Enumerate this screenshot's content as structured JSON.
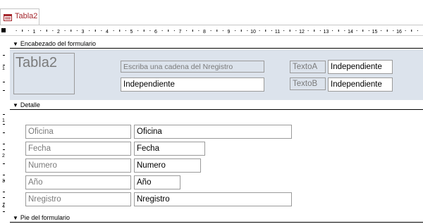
{
  "tab": {
    "label": "Tabla2"
  },
  "ruler": {
    "top_numbers": [
      "1",
      "2",
      "3",
      "4",
      "5",
      "6",
      "7",
      "8",
      "9",
      "10",
      "11",
      "12",
      "13",
      "14",
      "15",
      "16"
    ],
    "left_numbers": [
      "1",
      "1",
      "2",
      "3",
      "4"
    ]
  },
  "sections": {
    "header_label": "Encabezado del formulario",
    "detail_label": "Detalle",
    "footer_label": "Pie del formulario"
  },
  "header": {
    "title": "Tabla2",
    "prompt": "Escriba una cadena del Nregistro",
    "unbound_value": "Independiente",
    "textoA_label": "TextoA",
    "textoA_value": "Independiente",
    "textoB_label": "TextoB",
    "textoB_value": "Independiente"
  },
  "detail": {
    "fields": [
      {
        "label": "Oficina",
        "value": "Oficina"
      },
      {
        "label": "Fecha",
        "value": "Fecha"
      },
      {
        "label": "Numero",
        "value": "Numero"
      },
      {
        "label": "Año",
        "value": "Año"
      },
      {
        "label": "Nregistro",
        "value": "Nregistro"
      }
    ]
  },
  "colors": {
    "tab_label": "#a4262c",
    "header_bg": "#dce3ec",
    "border": "#9a9a9a"
  }
}
